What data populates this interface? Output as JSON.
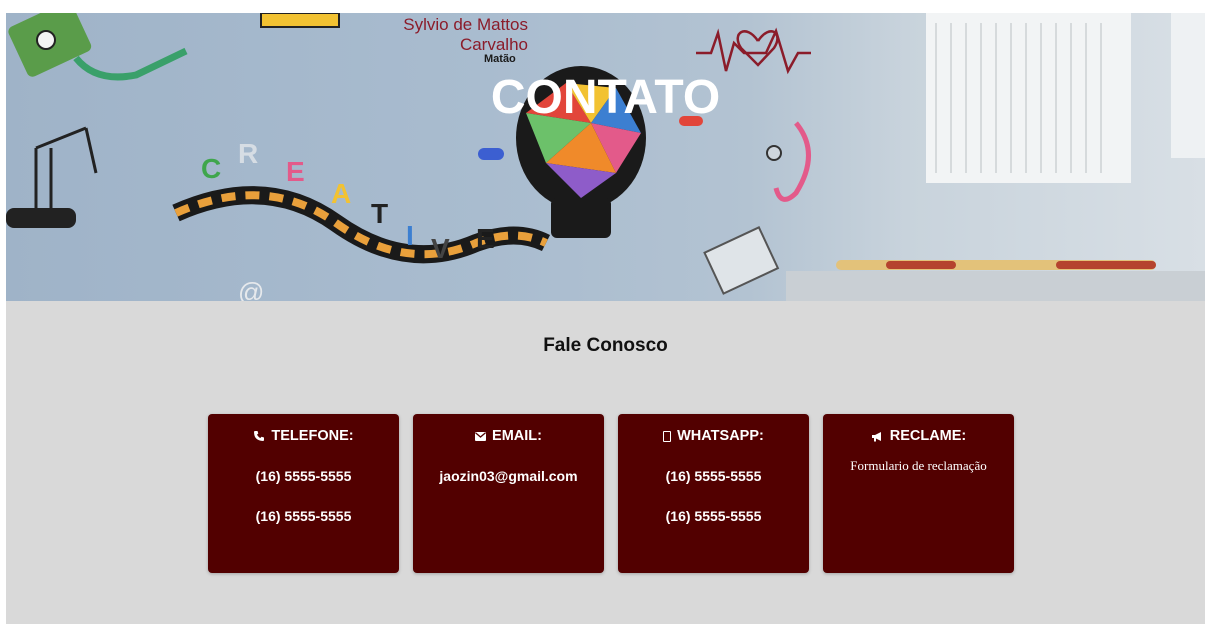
{
  "hero": {
    "title": "CONTATO",
    "mural_text": [
      "Sylvio de Mattos",
      "Carvalho"
    ],
    "mural_city": "Matão"
  },
  "section": {
    "title": "Fale Conosco"
  },
  "cards": [
    {
      "icon": "phone-icon",
      "heading": "TELEFONE:",
      "lines": [
        "(16) 5555-5555",
        "(16) 5555-5555"
      ]
    },
    {
      "icon": "mail-icon",
      "heading": "EMAIL:",
      "lines": [
        "jaozin03@gmail.com"
      ]
    },
    {
      "icon": "whatsapp-icon",
      "heading": "WHATSAPP:",
      "lines": [
        "(16) 5555-5555",
        "(16) 5555-5555"
      ]
    },
    {
      "icon": "megaphone-icon",
      "heading": "RECLAME:",
      "lines": [
        "Formulario de reclamação"
      ]
    }
  ],
  "colors": {
    "card_bg": "#520000",
    "page_bg": "#d9d9d9"
  }
}
